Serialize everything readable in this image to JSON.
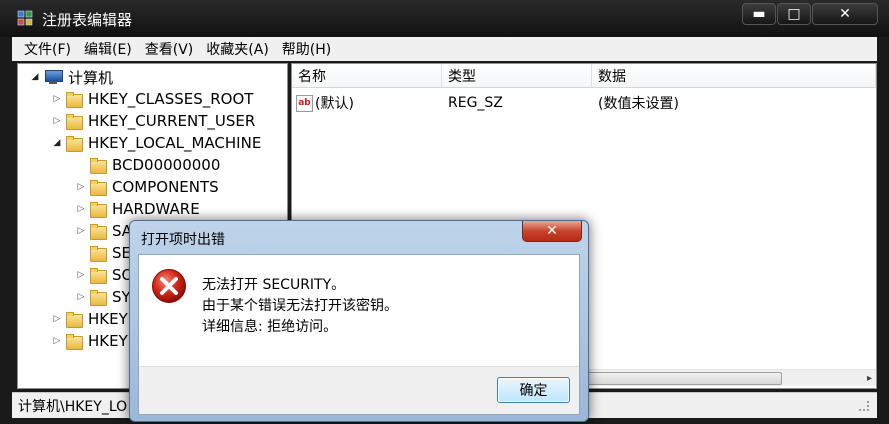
{
  "window": {
    "title": "注册表编辑器",
    "controls": {
      "minimize": "▬",
      "maximize": "□",
      "close": "✕"
    }
  },
  "menu": [
    "文件(F)",
    "编辑(E)",
    "查看(V)",
    "收藏夹(A)",
    "帮助(H)"
  ],
  "tree": {
    "root": "计算机",
    "items": [
      {
        "label": "HKEY_CLASSES_ROOT",
        "icon": "folder-icon"
      },
      {
        "label": "HKEY_CURRENT_USER",
        "icon": "folder-icon"
      },
      {
        "label": "HKEY_LOCAL_MACHINE",
        "icon": "folder-icon"
      },
      {
        "label": "BCD00000000",
        "icon": "folder-icon"
      },
      {
        "label": "COMPONENTS",
        "icon": "folder-icon"
      },
      {
        "label": "HARDWARE",
        "icon": "folder-icon"
      },
      {
        "label": "SA",
        "icon": "folder-icon"
      },
      {
        "label": "SE",
        "icon": "folder-icon"
      },
      {
        "label": "SO",
        "icon": "folder-icon"
      },
      {
        "label": "SY",
        "icon": "folder-icon"
      },
      {
        "label": "HKEY",
        "icon": "folder-icon"
      },
      {
        "label": "HKEY",
        "icon": "folder-icon"
      }
    ]
  },
  "list": {
    "columns": [
      "名称",
      "类型",
      "数据"
    ],
    "rows": [
      {
        "name": "(默认)",
        "type": "REG_SZ",
        "data": "(数值未设置)",
        "icon": "string-value-icon"
      }
    ]
  },
  "statusbar": {
    "path": "计算机\\HKEY_LO"
  },
  "dialog": {
    "title": "打开项时出错",
    "close": "✕",
    "icon": "error-icon",
    "lines": [
      "无法打开 SECURITY。",
      "由于某个错误无法打开该密钥。",
      "详细信息: 拒绝访问。"
    ],
    "ok_label": "确定"
  }
}
